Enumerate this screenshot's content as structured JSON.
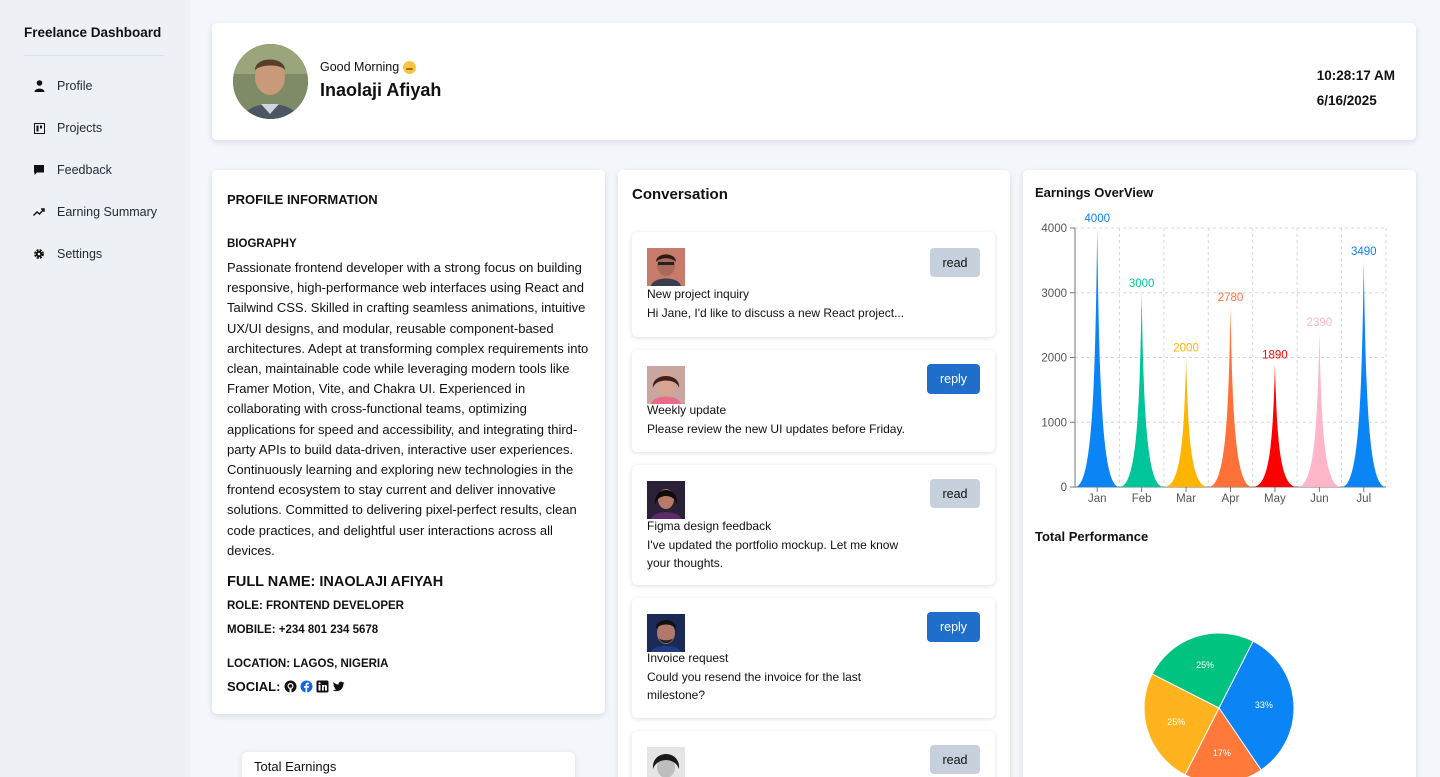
{
  "sidebar": {
    "brand": "Freelance Dashboard",
    "items": [
      {
        "label": "Profile",
        "icon": "user-icon"
      },
      {
        "label": "Projects",
        "icon": "projects-icon"
      },
      {
        "label": "Feedback",
        "icon": "chat-icon"
      },
      {
        "label": "Earning Summary",
        "icon": "trend-icon"
      },
      {
        "label": "Settings",
        "icon": "gear-icon"
      }
    ]
  },
  "header": {
    "greeting": "Good Morning",
    "name": "Inaolaji Afiyah",
    "time": "10:28:17 AM",
    "date": "6/16/2025"
  },
  "profile": {
    "section_title": "PROFILE INFORMATION",
    "bio_title": "BIOGRAPHY",
    "bio": "Passionate frontend developer with a strong focus on building responsive, high-performance web interfaces using React and Tailwind CSS. Skilled in crafting seamless animations, intuitive UX/UI designs, and modular, reusable component-based architectures. Adept at transforming complex requirements into clean, maintainable code while leveraging modern tools like Framer Motion, Vite, and Chakra UI. Experienced in collaborating with cross-functional teams, optimizing applications for speed and accessibility, and integrating third-party APIs to build data-driven, interactive user experiences. Continuously learning and exploring new technologies in the frontend ecosystem to stay current and deliver innovative solutions. Committed to delivering pixel-perfect results, clean code practices, and delightful user interactions across all devices.",
    "full_name": "FULL NAME: INAOLAJI AFIYAH",
    "role": "ROLE: FRONTEND DEVELOPER",
    "mobile": "MOBILE: +234 801 234 5678",
    "location": "LOCATION: LAGOS, NIGERIA",
    "social_label": "SOCIAL:",
    "social_icons": [
      "github-icon",
      "facebook-icon",
      "linkedin-icon",
      "twitter-icon"
    ]
  },
  "earnings_card": {
    "label": "Total Earnings"
  },
  "conversation": {
    "title": "Conversation",
    "messages": [
      {
        "subject": "New project inquiry",
        "body": "Hi Jane, I'd like to discuss a new React project...",
        "action": "read"
      },
      {
        "subject": "Weekly update",
        "body": "Please review the new UI updates before Friday.",
        "action": "reply"
      },
      {
        "subject": "Figma design feedback",
        "body": "I've updated the portfolio mockup. Let me know your thoughts.",
        "action": "read"
      },
      {
        "subject": "Invoice request",
        "body": "Could you resend the invoice for the last milestone?",
        "action": "reply"
      },
      {
        "subject": "",
        "body": "",
        "action": "read"
      }
    ]
  },
  "earnings_overview": {
    "title": "Earnings OverView"
  },
  "performance": {
    "title": "Total Performance"
  },
  "chart_data": [
    {
      "type": "area",
      "title": "Earnings OverView",
      "categories": [
        "Jan",
        "Feb",
        "Mar",
        "Apr",
        "May",
        "Jun",
        "Jul"
      ],
      "values": [
        4000,
        3000,
        2000,
        2780,
        1890,
        2390,
        3490
      ],
      "colors": [
        "#0b84f5",
        "#00c49a",
        "#ffb400",
        "#ff7139",
        "#ff0000",
        "#ffb6c8",
        "#0b84f5"
      ],
      "yticks": [
        0,
        1000,
        2000,
        3000,
        4000
      ],
      "ylim": [
        0,
        4000
      ],
      "grid": true
    },
    {
      "type": "pie",
      "title": "Total Performance",
      "labels": [
        "33%",
        "17%",
        "25%",
        "25%"
      ],
      "values": [
        33,
        17,
        25,
        25
      ],
      "colors": [
        "#0b84f5",
        "#ff7a3a",
        "#ffb41f",
        "#00c37f"
      ]
    }
  ]
}
